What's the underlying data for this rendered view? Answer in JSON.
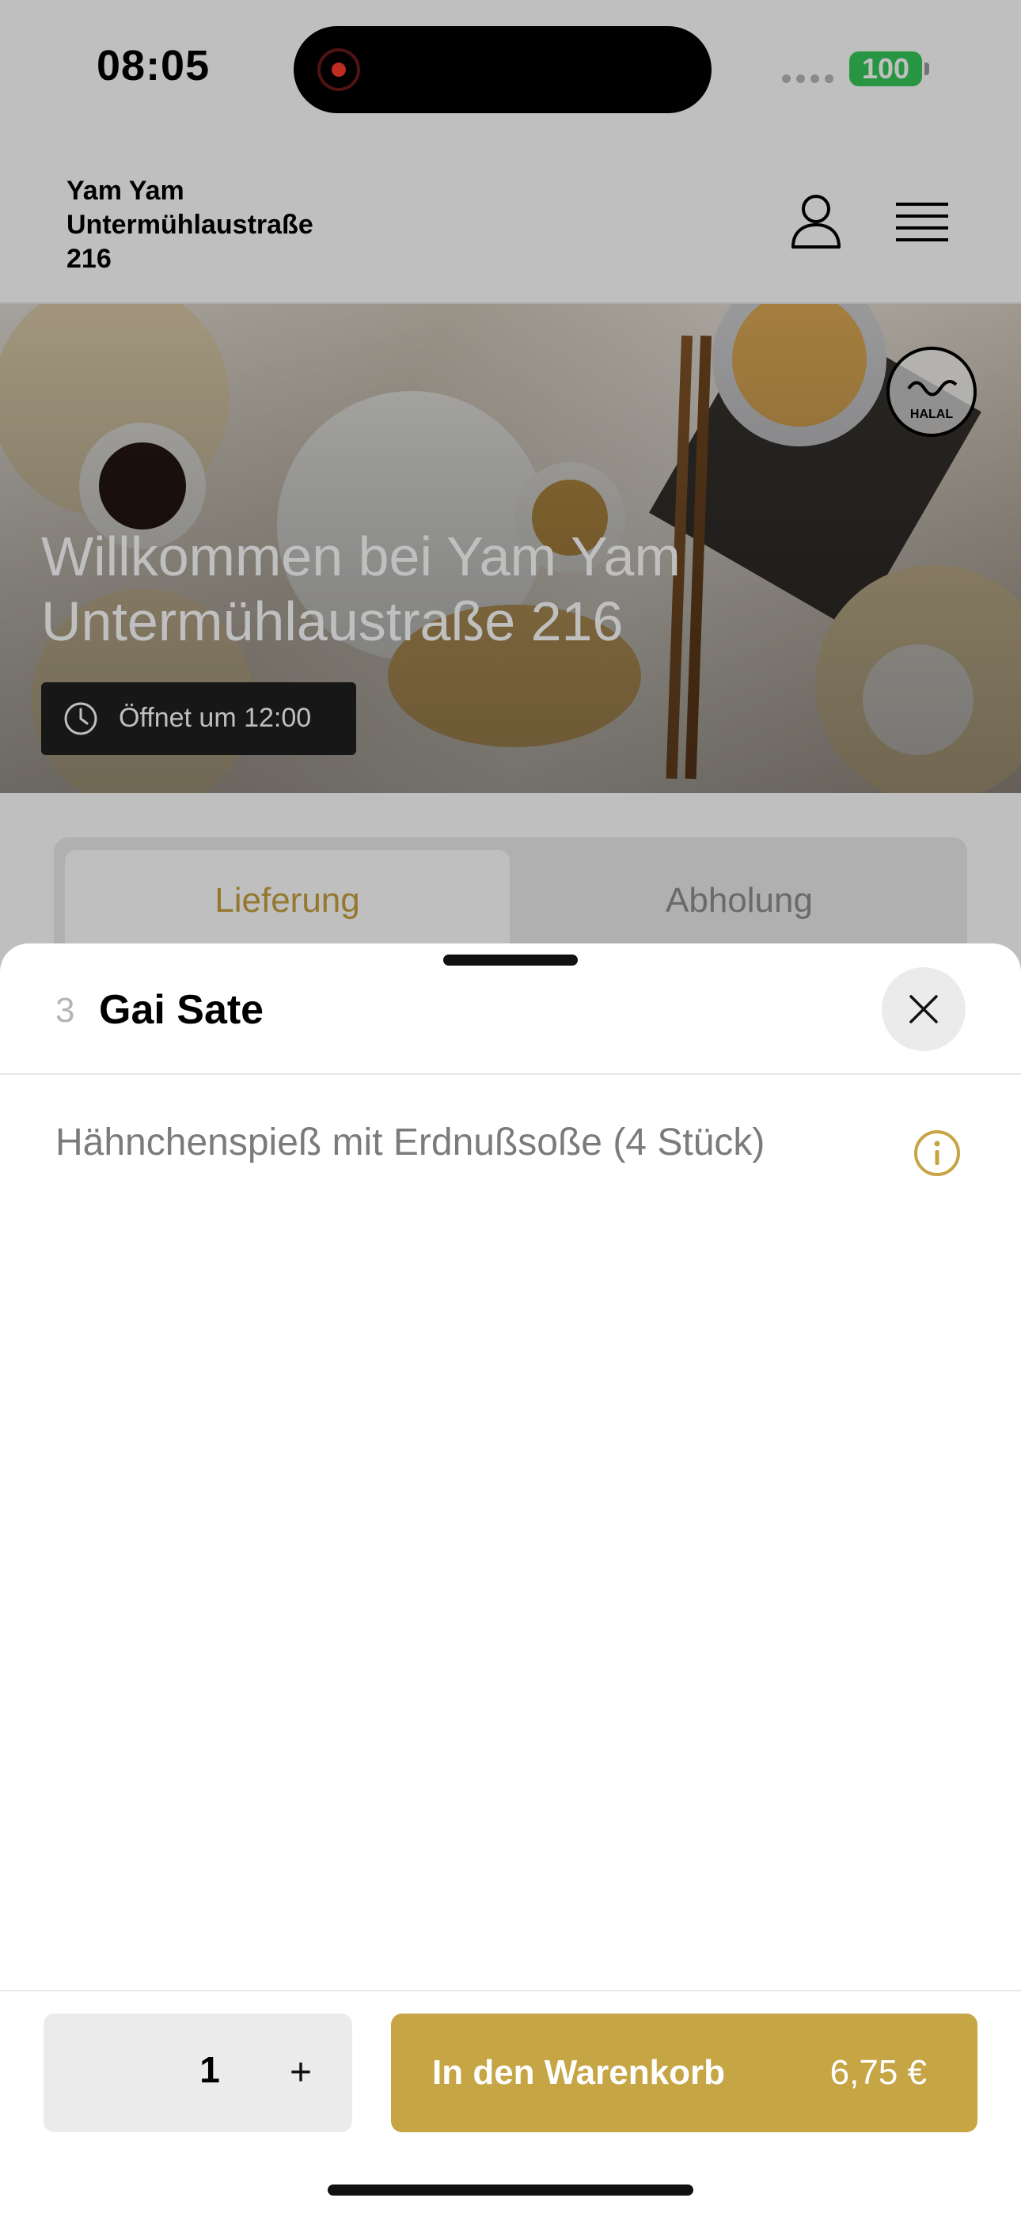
{
  "status_bar": {
    "time": "08:05",
    "battery": "100"
  },
  "header": {
    "restaurant_name": "Yam Yam\nUntermühlaustraße\n216",
    "icons": {
      "account": "user-icon",
      "menu": "hamburger-menu-icon"
    }
  },
  "hero": {
    "welcome_title": "Willkommen bei Yam Yam Untermühlaustraße 216",
    "hours_badge": "Öffnet um 12:00",
    "halal_logo_text": "HALAL"
  },
  "order_type_tabs": [
    {
      "label": "Lieferung",
      "active": true
    },
    {
      "label": "Abholung",
      "active": false
    }
  ],
  "product_sheet": {
    "item_number": "3",
    "item_name": "Gai Sate",
    "description": "Hähnchenspieß mit Erdnußsoße (4 Stück)",
    "quantity": "1",
    "plus_label": "+",
    "add_to_cart_label": "In den Warenkorb",
    "price": "6,75 €"
  },
  "colors": {
    "accent_gold": "#c6a545",
    "battery_green": "#34c759"
  }
}
